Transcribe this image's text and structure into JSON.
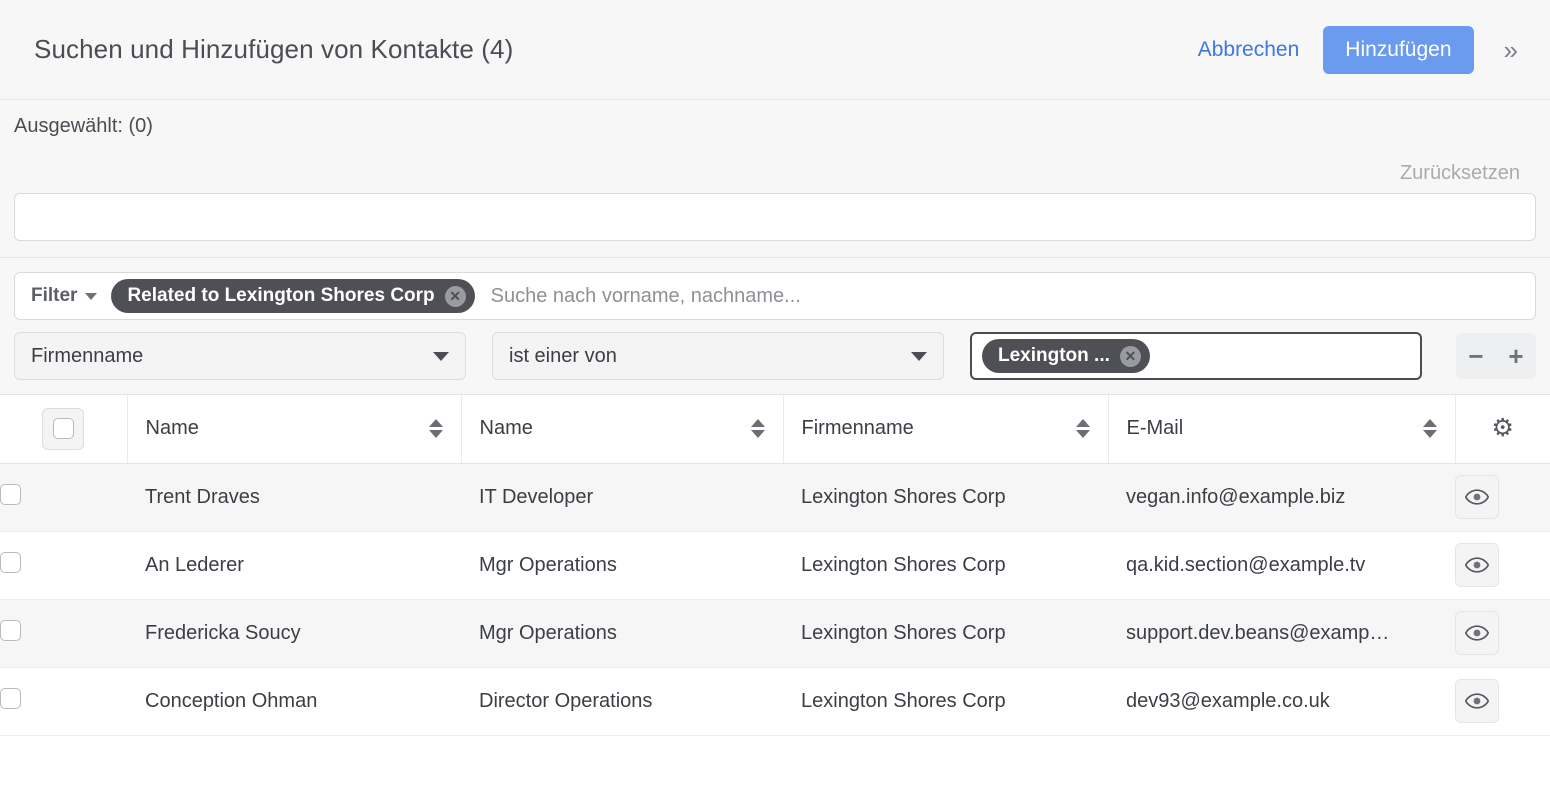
{
  "header": {
    "title": "Suchen und Hinzufügen von Kontakte (4)",
    "cancel_label": "Abbrechen",
    "add_label": "Hinzufügen",
    "expand_icon": "»"
  },
  "toolbar": {
    "selected_label": "Ausgewählt: (0)",
    "reset_label": "Zurücksetzen",
    "top_search_value": "",
    "top_search_placeholder": ""
  },
  "filter": {
    "label": "Filter",
    "chip_label": "Related to Lexington Shores Corp",
    "chip_remove_icon": "✕",
    "search_placeholder": "Suche nach vorname, nachname...",
    "search_value": ""
  },
  "condition": {
    "field": "Firmenname",
    "operator": "ist einer von",
    "value_chip": "Lexington ...",
    "value_chip_remove_icon": "✕",
    "remove_row_icon": "−",
    "add_row_icon": "+"
  },
  "table": {
    "columns": [
      {
        "label": "Name",
        "sortable": true
      },
      {
        "label": "Name",
        "sortable": true
      },
      {
        "label": "Firmenname",
        "sortable": true
      },
      {
        "label": "E-Mail",
        "sortable": true
      }
    ],
    "gear_icon": "⚙",
    "row_action_icon": "eye-icon",
    "rows": [
      {
        "name": "Trent Draves",
        "title": "IT Developer",
        "company": "Lexington Shores Corp",
        "email": "vegan.info@example.biz"
      },
      {
        "name": "An Lederer",
        "title": "Mgr Operations",
        "company": "Lexington Shores Corp",
        "email": "qa.kid.section@example.tv"
      },
      {
        "name": "Fredericka Soucy",
        "title": "Mgr Operations",
        "company": "Lexington Shores Corp",
        "email": "support.dev.beans@examp…"
      },
      {
        "name": "Conception Ohman",
        "title": "Director Operations",
        "company": "Lexington Shores Corp",
        "email": "dev93@example.co.uk"
      }
    ]
  },
  "colors": {
    "accent": "#6b9bef",
    "link": "#3f76e0",
    "chip_bg": "#4f5055",
    "panel_bg": "#f7f7f8",
    "row_alt_bg": "#f6f6f7"
  }
}
